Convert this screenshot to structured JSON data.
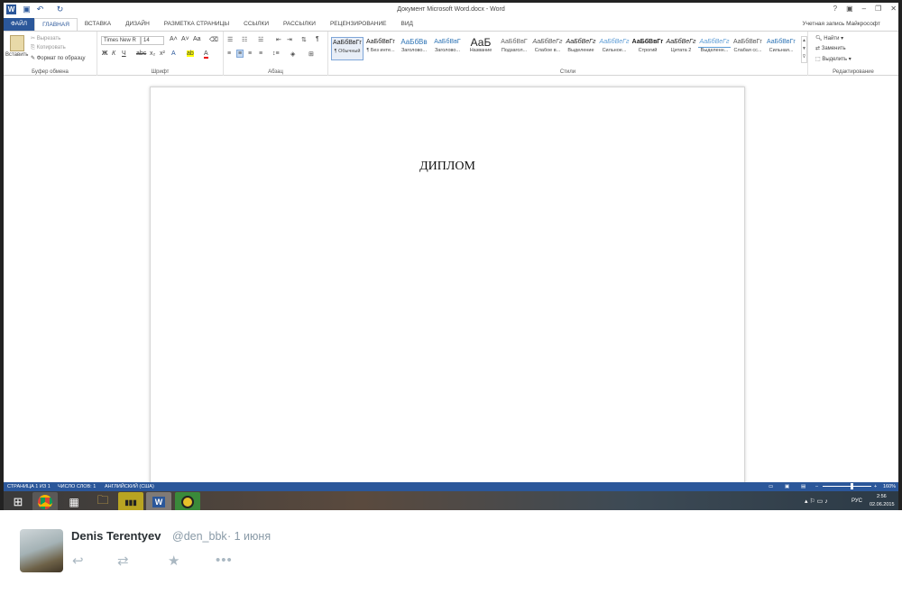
{
  "window": {
    "title": "Документ Microsoft Word.docx - Word",
    "account": "Учетная запись Майкрософт",
    "help": "?",
    "minimize": "–",
    "restore": "❐",
    "close": "✕"
  },
  "tabs": [
    "ФАЙЛ",
    "ГЛАВНАЯ",
    "ВСТАВКА",
    "ДИЗАЙН",
    "РАЗМЕТКА СТРАНИЦЫ",
    "ССЫЛКИ",
    "РАССЫЛКИ",
    "РЕЦЕНЗИРОВАНИЕ",
    "ВИД"
  ],
  "clipboard": {
    "paste": "Вставить",
    "cut": "Вырезать",
    "copy": "Копировать",
    "format_painter": "Формат по образцу",
    "label": "Буфер обмена"
  },
  "font": {
    "name": "Times New R",
    "size": "14",
    "label": "Шрифт"
  },
  "paragraph": {
    "label": "Абзац"
  },
  "styles": {
    "label": "Стили",
    "items": [
      {
        "preview": "АаБбВвГг",
        "name": "¶ Обычный"
      },
      {
        "preview": "АаБбВвГг",
        "name": "¶ Без инте..."
      },
      {
        "preview": "АаБбВв",
        "name": "Заголово..."
      },
      {
        "preview": "АаБбВвГ",
        "name": "Заголово..."
      },
      {
        "preview": "АаБ",
        "name": "Название"
      },
      {
        "preview": "АаБбВвГ",
        "name": "Подзагол..."
      },
      {
        "preview": "АаБбВеГг",
        "name": "Слабое в..."
      },
      {
        "preview": "АаБбВеГг",
        "name": "Выделение"
      },
      {
        "preview": "АаБбВеГг",
        "name": "Сильное..."
      },
      {
        "preview": "АаБбВвГг",
        "name": "Строгий"
      },
      {
        "preview": "АаБбВеГг",
        "name": "Цитата 2"
      },
      {
        "preview": "АаБбВеГг",
        "name": "Выделенн..."
      },
      {
        "preview": "АаБбВвГг",
        "name": "Слабая сс..."
      },
      {
        "preview": "АаБбВвГг",
        "name": "Сильная..."
      }
    ]
  },
  "editing": {
    "find": "Найти",
    "replace": "Заменить",
    "select": "Выделить",
    "label": "Редактирование"
  },
  "document": {
    "text": "ДИПЛОМ"
  },
  "status": {
    "page": "СТРАНИЦА 1 ИЗ 1",
    "words": "ЧИСЛО СЛОВ: 1",
    "lang": "АНГЛИЙСКИЙ (США)",
    "zoom": "160%"
  },
  "taskbar": {
    "lang": "РУС",
    "time": "2:56",
    "date": "02.06.2015"
  },
  "tweet": {
    "name": "Denis Terentyev",
    "handle": "@den_bbk",
    "date": "· 1 июня"
  }
}
